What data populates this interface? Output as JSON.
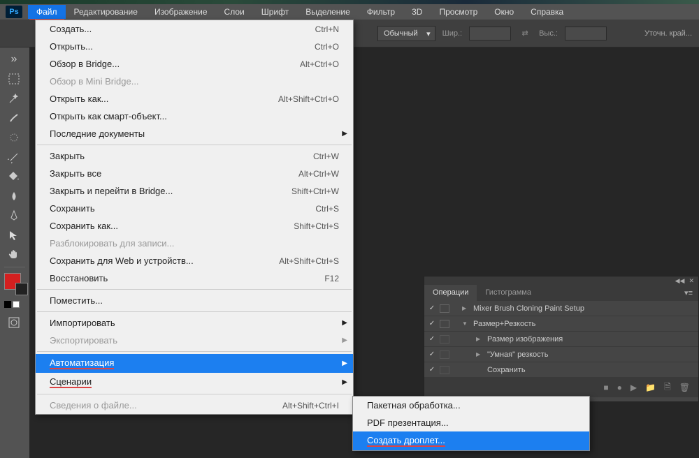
{
  "app": {
    "logo": "Ps"
  },
  "menubar": {
    "items": [
      "Файл",
      "Редактирование",
      "Изображение",
      "Слои",
      "Шрифт",
      "Выделение",
      "Фильтр",
      "3D",
      "Просмотр",
      "Окно",
      "Справка"
    ],
    "active_index": 0
  },
  "optionsbar": {
    "mode_label": "Обычный",
    "width_label": "Шир.:",
    "height_label": "Выс.:",
    "refine_label": "Уточн. край..."
  },
  "file_menu": {
    "groups": [
      [
        {
          "label": "Создать...",
          "shortcut": "Ctrl+N"
        },
        {
          "label": "Открыть...",
          "shortcut": "Ctrl+O"
        },
        {
          "label": "Обзор в Bridge...",
          "shortcut": "Alt+Ctrl+O"
        },
        {
          "label": "Обзор в Mini Bridge...",
          "shortcut": "",
          "disabled": true
        },
        {
          "label": "Открыть как...",
          "shortcut": "Alt+Shift+Ctrl+O"
        },
        {
          "label": "Открыть как смарт-объект...",
          "shortcut": ""
        },
        {
          "label": "Последние документы",
          "shortcut": "",
          "submenu": true
        }
      ],
      [
        {
          "label": "Закрыть",
          "shortcut": "Ctrl+W"
        },
        {
          "label": "Закрыть все",
          "shortcut": "Alt+Ctrl+W"
        },
        {
          "label": "Закрыть и перейти в Bridge...",
          "shortcut": "Shift+Ctrl+W"
        },
        {
          "label": "Сохранить",
          "shortcut": "Ctrl+S"
        },
        {
          "label": "Сохранить как...",
          "shortcut": "Shift+Ctrl+S"
        },
        {
          "label": "Разблокировать для записи...",
          "shortcut": "",
          "disabled": true
        },
        {
          "label": "Сохранить для Web и устройств...",
          "shortcut": "Alt+Shift+Ctrl+S"
        },
        {
          "label": "Восстановить",
          "shortcut": "F12"
        }
      ],
      [
        {
          "label": "Поместить...",
          "shortcut": ""
        }
      ],
      [
        {
          "label": "Импортировать",
          "shortcut": "",
          "submenu": true
        },
        {
          "label": "Экспортировать",
          "shortcut": "",
          "submenu": true,
          "disabled": true
        }
      ],
      [
        {
          "label": "Автоматизация",
          "shortcut": "",
          "submenu": true,
          "highlighted": true,
          "underlined": true
        },
        {
          "label": "Сценарии",
          "shortcut": "",
          "submenu": true,
          "underlined": true
        }
      ],
      [
        {
          "label": "Сведения о файле...",
          "shortcut": "Alt+Shift+Ctrl+I",
          "disabled": true
        }
      ]
    ]
  },
  "submenu_automation": {
    "items": [
      {
        "label": "Пакетная обработка..."
      },
      {
        "label": "PDF презентация..."
      },
      {
        "label": "Создать дроплет...",
        "highlighted": true,
        "underlined": true
      }
    ]
  },
  "actions_panel": {
    "tabs": [
      "Операции",
      "Гистограмма"
    ],
    "active_tab": 0,
    "rows": [
      {
        "check": true,
        "dialog": true,
        "indent": 0,
        "expand": "▶",
        "label": "Mixer Brush Cloning Paint Setup"
      },
      {
        "check": true,
        "dialog": true,
        "indent": 0,
        "expand": "▼",
        "label": "Размер+Резкость"
      },
      {
        "check": true,
        "dialog": false,
        "indent": 1,
        "expand": "▶",
        "label": "Размер изображения"
      },
      {
        "check": true,
        "dialog": false,
        "indent": 1,
        "expand": "▶",
        "label": "\"Умная\" резкость"
      },
      {
        "check": true,
        "dialog": false,
        "indent": 1,
        "expand": "",
        "label": "Сохранить"
      }
    ],
    "footer_icons": [
      "■",
      "●",
      "▶",
      "📁",
      "🗎",
      "🗑"
    ]
  }
}
